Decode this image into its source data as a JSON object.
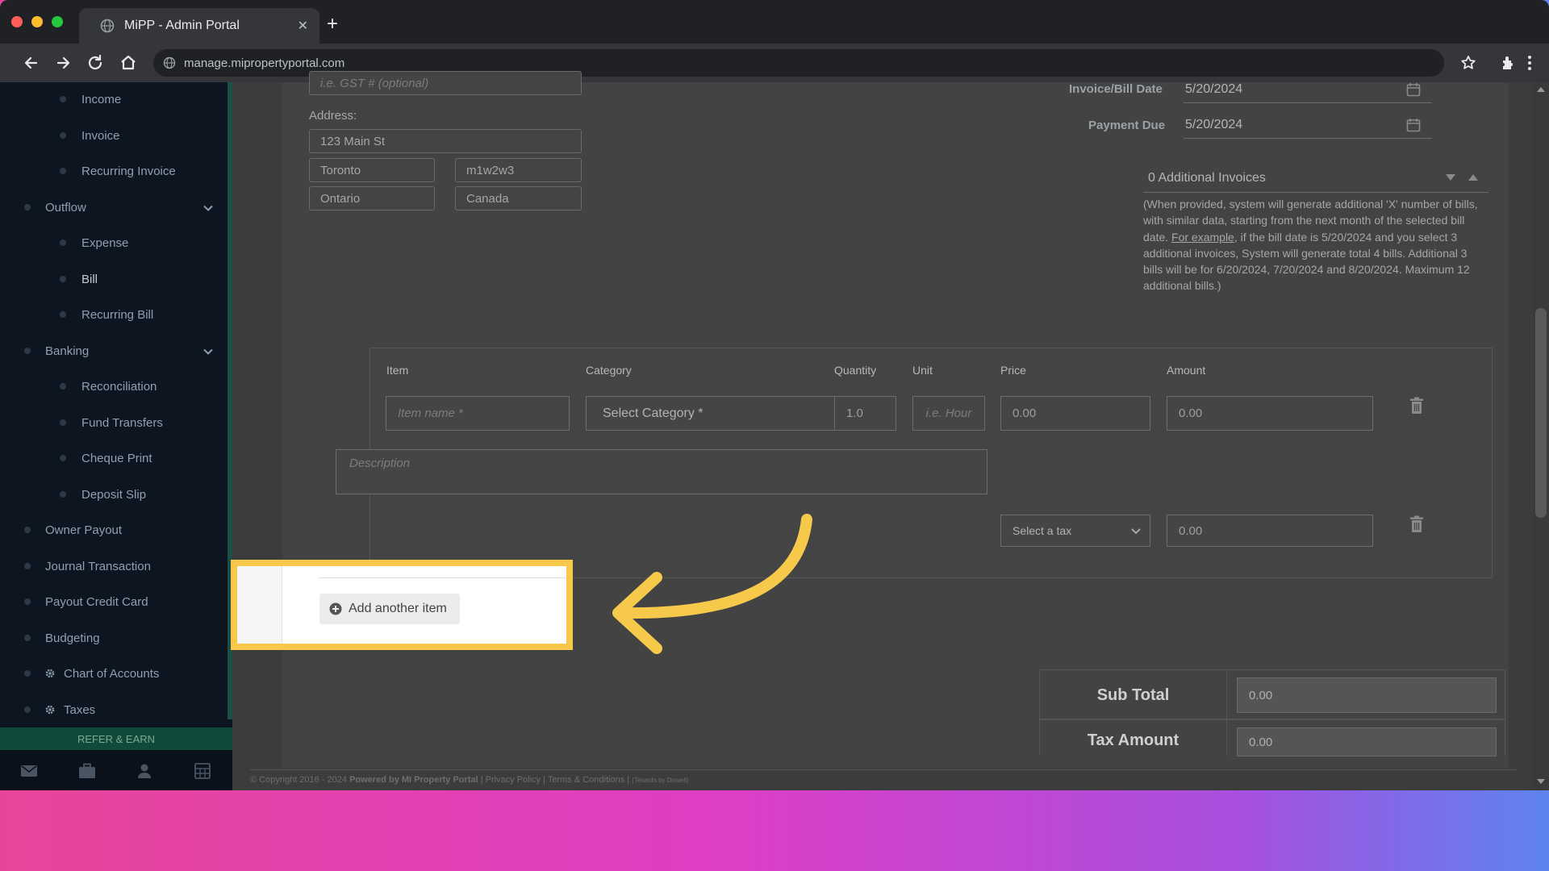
{
  "browser": {
    "tab_title": "MiPP - Admin Portal",
    "url": "manage.mipropertyportal.com"
  },
  "sidebar": {
    "items": [
      {
        "label": "Income",
        "level": "sub"
      },
      {
        "label": "Invoice",
        "level": "sub"
      },
      {
        "label": "Recurring Invoice",
        "level": "sub"
      },
      {
        "label": "Outflow",
        "level": "top",
        "expandable": true
      },
      {
        "label": "Expense",
        "level": "sub"
      },
      {
        "label": "Bill",
        "level": "sub",
        "active": true
      },
      {
        "label": "Recurring Bill",
        "level": "sub"
      },
      {
        "label": "Banking",
        "level": "top",
        "expandable": true
      },
      {
        "label": "Reconciliation",
        "level": "sub"
      },
      {
        "label": "Fund Transfers",
        "level": "sub"
      },
      {
        "label": "Cheque Print",
        "level": "sub"
      },
      {
        "label": "Deposit Slip",
        "level": "sub"
      },
      {
        "label": "Owner Payout",
        "level": "top"
      },
      {
        "label": "Journal Transaction",
        "level": "top"
      },
      {
        "label": "Payout Credit Card",
        "level": "top"
      },
      {
        "label": "Budgeting",
        "level": "top"
      },
      {
        "label": "Chart of Accounts",
        "level": "top",
        "icon": "gear-icon"
      },
      {
        "label": "Taxes",
        "level": "top",
        "icon": "gear-icon"
      }
    ],
    "refer_label": "REFER & EARN",
    "bottom_icons": [
      "mail-icon",
      "briefcase-icon",
      "user-icon",
      "calculator-icon"
    ]
  },
  "form": {
    "gst_placeholder": "i.e. GST # (optional)",
    "address_label": "Address:",
    "street": "123 Main St",
    "city": "Toronto",
    "postal": "m1w2w3",
    "province": "Ontario",
    "country": "Canada",
    "bill_date_label": "Invoice/Bill Date",
    "bill_date": "5/20/2024",
    "payment_due_label": "Payment Due",
    "payment_due": "5/20/2024",
    "additional_invoices": "0 Additional Invoices",
    "help_text_1": "(When provided, system will generate additional 'X' number of bills, with similar data, starting from the next month of the selected bill date. ",
    "help_link": "For example",
    "help_text_2": ", if the bill date is 5/20/2024 and you select 3 additional invoices, System will generate total 4 bills. Additional 3 bills will be for 6/20/2024, 7/20/2024 and 8/20/2024. Maximum 12 additional bills.)"
  },
  "items_table": {
    "headers": {
      "item": "Item",
      "category": "Category",
      "quantity": "Quantity",
      "unit": "Unit",
      "price": "Price",
      "amount": "Amount"
    },
    "row": {
      "item_placeholder": "Item name *",
      "category": "Select Category *",
      "quantity": "1.0",
      "unit_placeholder": "i.e. Hour",
      "price": "0.00",
      "amount": "0.00",
      "description_placeholder": "Description",
      "tax": "Select a tax",
      "tax_amount": "0.00"
    },
    "add_item_label": "Add another item"
  },
  "totals": {
    "subtotal_label": "Sub Total",
    "subtotal": "0.00",
    "tax_label": "Tax Amount",
    "tax": "0.00"
  },
  "footer": {
    "copyright": "© Copyright 2016 - 2024",
    "powered": "Powered by MI Property Portal",
    "links": "| Privacy Policy | Terms & Conditions |",
    "tenants": "(Tenants by Dowell)"
  },
  "colors": {
    "highlight": "#f6c94a",
    "sidebar_bg": "#0c1520",
    "refer_bg": "#0f4a3a"
  }
}
